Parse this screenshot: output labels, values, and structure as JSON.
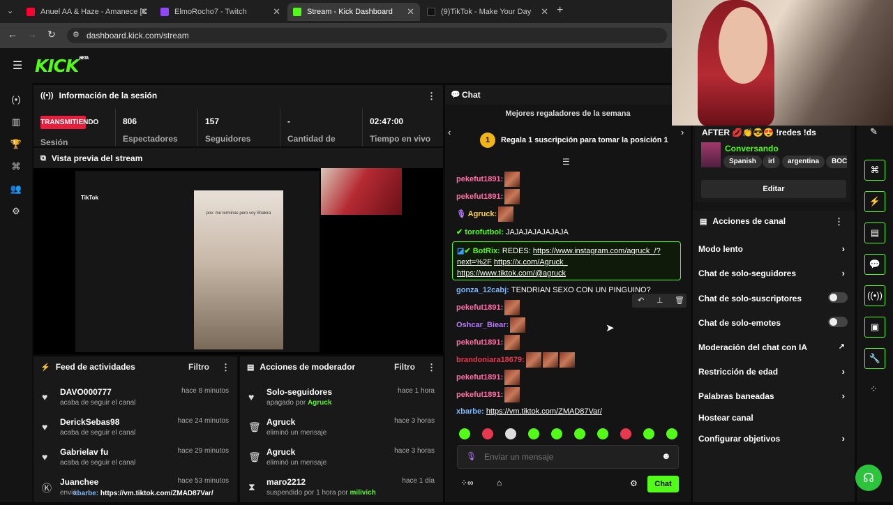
{
  "browser": {
    "tabs": [
      {
        "title": "Anuel AA & Haze - Amanece [C",
        "color": "#ff0033"
      },
      {
        "title": "ElmoRocho7 - Twitch",
        "color": "#9146ff"
      },
      {
        "title": "Stream - Kick Dashboard",
        "color": "#53fc18"
      },
      {
        "title": "(9)TikTok - Make Your Day",
        "color": "#111111"
      }
    ],
    "url": "dashboard.kick.com/stream"
  },
  "logo": {
    "text": "KICK",
    "sup": "BETA"
  },
  "session": {
    "title": "Información de la sesión",
    "status": "TRANSMITIENDO",
    "status_sub": "Sesión",
    "stats": [
      {
        "value": "806",
        "label": "Espectadores"
      },
      {
        "value": "157",
        "label": "Seguidores"
      },
      {
        "value": "-",
        "label": "Cantidad de"
      },
      {
        "value": "02:47:00",
        "label": "Tiempo en vivo"
      }
    ]
  },
  "preview": {
    "title": "Vista previa del stream",
    "caption": "pov: me terminas pero soy Shakira",
    "brand": "TikTok"
  },
  "feed": {
    "title": "Feed de actividades",
    "filter": "Filtro",
    "items": [
      {
        "name": "DAVO000777",
        "sub": "acaba de seguir el canal",
        "time": "hace 8 minutos"
      },
      {
        "name": "DerickSebas98",
        "sub": "acaba de seguir el canal",
        "time": "hace 24 minutos"
      },
      {
        "name": "Gabrielav fu",
        "sub": "acaba de seguir el canal",
        "time": "hace 29 minutos"
      },
      {
        "name": "Juanchee",
        "sub": "envió",
        "time": "hace 53 minutos"
      }
    ]
  },
  "modact": {
    "title": "Acciones de moderador",
    "filter": "Filtro",
    "items": [
      {
        "name": "Solo-seguidores",
        "sub": "apagado por",
        "by": "Agruck",
        "time": "hace 1 hora"
      },
      {
        "name": "Agruck",
        "sub": "eliminó un mensaje",
        "by": "",
        "time": "hace 3 horas"
      },
      {
        "name": "Agruck",
        "sub": "eliminó un mensaje",
        "by": "",
        "time": "hace 3 horas"
      },
      {
        "name": "maro2212",
        "sub": "suspendido por 1 hora por",
        "by": "milivich",
        "time": "hace 1 día"
      }
    ]
  },
  "chat": {
    "title": "Chat",
    "gifters_title": "Mejores regaladores de la semana",
    "gifters_text": "Regala 1 suscripción para tomar la posición 1",
    "rank": "1",
    "messages": [
      {
        "user": "pekefut1891:",
        "color": "#ff6fa5",
        "text": ""
      },
      {
        "user": "pekefut1891:",
        "color": "#ff6fa5",
        "text": ""
      },
      {
        "user": "Agruck:",
        "color": "#ffd23f",
        "text": ""
      },
      {
        "user": "torofutbol:",
        "color": "#53fc18",
        "text": "JAJAJAJAJAJAJA"
      },
      {
        "user": "gonza_12cabj:",
        "color": "#7ab8ff",
        "text": "TENDRIAN SEXO CON UN PINGUINO?"
      },
      {
        "user": "pekefut1891:",
        "color": "#ff6fa5",
        "text": ""
      },
      {
        "user": "Oshcar_Biear:",
        "color": "#b87aff",
        "text": ""
      },
      {
        "user": "pekefut1891:",
        "color": "#ff6fa5",
        "text": ""
      },
      {
        "user": "brandoniara18679:",
        "color": "#e63950",
        "text": ""
      },
      {
        "user": "pekefut1891:",
        "color": "#ff6fa5",
        "text": ""
      },
      {
        "user": "pekefut1891:",
        "color": "#ff6fa5",
        "text": ""
      },
      {
        "user": "xbarbe:",
        "color": "#7ab8ff",
        "text": "https://vm.tiktok.com/ZMAD87Var/"
      }
    ],
    "bot": {
      "user": "BotRix:",
      "prefix": "REDES:",
      "link1": "https://www.instagram.com/agruck_/?next=%2F",
      "link2": "https://x.com/Agruck_",
      "link3": "https://www.tiktok.com/@agruck"
    },
    "placeholder": "Enviar un mensaje",
    "send": "Chat"
  },
  "stream_card": {
    "title": "AFTER 💋👏😎😍 !redes !ds",
    "category": "Conversando",
    "tags": [
      "Spanish",
      "irl",
      "argentina",
      "BOC"
    ],
    "edit": "Editar"
  },
  "channel_actions": {
    "title": "Acciones de canal",
    "items": [
      {
        "label": "Modo lento",
        "kind": "chevron"
      },
      {
        "label": "Chat de solo-seguidores",
        "kind": "chevron"
      },
      {
        "label": "Chat de solo-suscriptores",
        "kind": "toggle"
      },
      {
        "label": "Chat de solo-emotes",
        "kind": "toggle"
      },
      {
        "label": "Moderación del chat con IA",
        "kind": "external"
      },
      {
        "label": "Restricción de edad",
        "kind": "chevron"
      },
      {
        "label": "Palabras baneadas",
        "kind": "chevron"
      },
      {
        "label": "Hostear canal",
        "kind": "none"
      },
      {
        "label": "Configurar objetivos",
        "kind": "chevron"
      }
    ]
  },
  "overlay": {
    "link": "https://vm.tiktok.com/ZMAD87Var/",
    "user": "xbarbe:"
  }
}
